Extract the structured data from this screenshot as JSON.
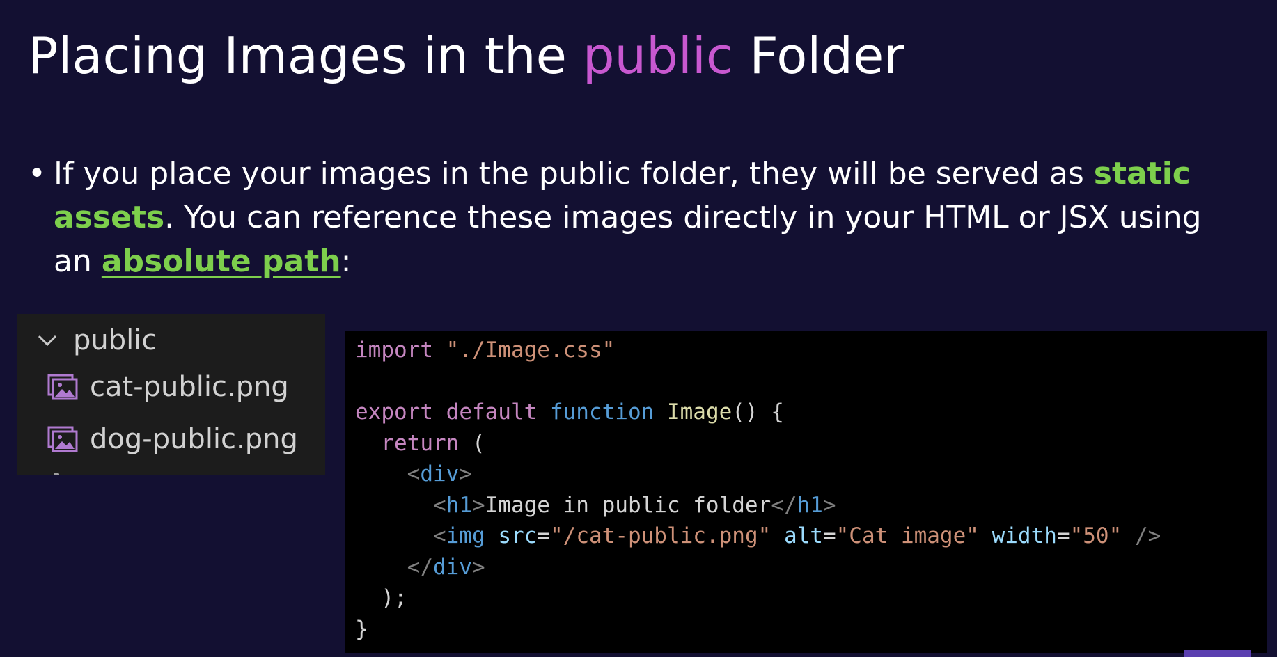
{
  "title": {
    "before": "Placing Images in the ",
    "accent": "public",
    "after": " Folder"
  },
  "bullet": {
    "dot": "•",
    "part1": "If you place your images in the public folder, they will be served as ",
    "highlight1": "static assets",
    "part2": ". You can reference these images directly in your HTML or JSX using an ",
    "highlight2": "absolute path",
    "part3": ":"
  },
  "explorer": {
    "folder": {
      "label": "public",
      "icon": "chevron-down-icon"
    },
    "files": [
      {
        "label": "cat-public.png",
        "icon": "image-file-icon"
      },
      {
        "label": "dog-public.png",
        "icon": "image-file-icon"
      }
    ]
  },
  "code": {
    "import_kw": "import",
    "import_path": "\"./Image.css\"",
    "export_kw": "export",
    "default_kw": "default",
    "function_kw": "function",
    "fn_name": "Image",
    "fn_sig_rest": "() {",
    "return_kw": "return",
    "open_paren": "(",
    "div_tag": "div",
    "h1_tag": "h1",
    "h1_text": "Image in public folder",
    "img_tag": "img",
    "attr_src": "src",
    "val_src": "\"/cat-public.png\"",
    "attr_alt": "alt",
    "val_alt": "\"Cat image\"",
    "attr_width": "width",
    "val_width": "\"50\"",
    "close_paren": ");",
    "close_brace": "}"
  },
  "colors": {
    "background": "#131032",
    "accent_purple": "#c858d0",
    "accent_green": "#7dcf4c",
    "explorer_bg": "#1c1c1c",
    "code_bg": "#000000"
  }
}
